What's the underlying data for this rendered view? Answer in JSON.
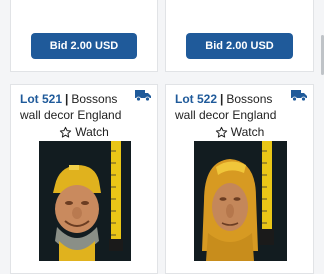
{
  "bid_cards": [
    {
      "button_label": "Bid 2.00 USD"
    },
    {
      "button_label": "Bid 2.00 USD"
    }
  ],
  "lots": [
    {
      "lot_number": "Lot 521",
      "separator": "|",
      "title_line1": "Bossons",
      "title_line2": "wall decor England",
      "watch_label": "Watch",
      "shipping_icon": "truck-icon",
      "image_alt": "Bossons wall plaque head with yellow hat"
    },
    {
      "lot_number": "Lot 522",
      "separator": "|",
      "title_line1": "Bossons",
      "title_line2": "wall decor England",
      "watch_label": "Watch",
      "shipping_icon": "truck-icon",
      "image_alt": "Bossons wall plaque head with yellow hood"
    }
  ],
  "colors": {
    "accent": "#1f5a9a",
    "card_bg": "#ffffff",
    "page_bg": "#f4f5f7"
  }
}
